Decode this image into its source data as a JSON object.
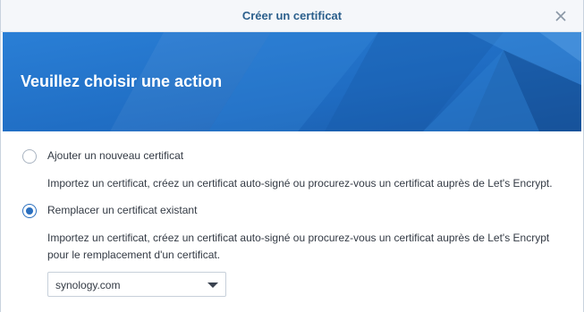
{
  "window": {
    "title": "Créer un certificat"
  },
  "banner": {
    "heading": "Veuillez choisir une action"
  },
  "options": [
    {
      "label": "Ajouter un nouveau certificat",
      "description": "Importez un certificat, créez un certificat auto-signé ou procurez-vous un certificat auprès de Let's Encrypt.",
      "selected": false
    },
    {
      "label": "Remplacer un certificat existant",
      "description_line1": "Importez un certificat, créez un certificat auto-signé ou procurez-vous un certificat auprès de Let's Encrypt",
      "description_line2": "pour le remplacement d'un certificat.",
      "selected": true
    }
  ],
  "certificate_select": {
    "value": "synology.com"
  },
  "colors": {
    "title_text": "#2b5f8c",
    "banner_blue": "#1f6fc4",
    "radio_accent": "#2a6fbf"
  }
}
